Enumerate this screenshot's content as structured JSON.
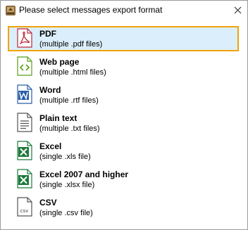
{
  "window": {
    "title": "Please select messages export format",
    "close_glyph": "✕"
  },
  "formats": [
    {
      "label": "PDF",
      "description": "(multiple .pdf files)",
      "icon": "pdf-file-icon",
      "selected": true
    },
    {
      "label": "Web page",
      "description": "(multiple .html files)",
      "icon": "html-file-icon",
      "selected": false
    },
    {
      "label": "Word",
      "description": "(multiple .rtf files)",
      "icon": "word-file-icon",
      "selected": false
    },
    {
      "label": "Plain text",
      "description": "(multiple .txt files)",
      "icon": "text-file-icon",
      "selected": false
    },
    {
      "label": "Excel",
      "description": "(single .xls file)",
      "icon": "excel-file-icon",
      "selected": false
    },
    {
      "label": "Excel 2007 and higher",
      "description": "(single .xlsx file)",
      "icon": "excel-xlsx-file-icon",
      "selected": false
    },
    {
      "label": "CSV",
      "description": "(single .csv file)",
      "icon": "csv-file-icon",
      "selected": false,
      "icon_text": "csv"
    }
  ],
  "colors": {
    "selection_border": "#f0a30a",
    "selection_fill": "#dbeefb",
    "pdf": "#b8283a",
    "html": "#5a9e1c",
    "word": "#2a5ea8",
    "excel": "#1e7a3c",
    "text": "#555555"
  }
}
